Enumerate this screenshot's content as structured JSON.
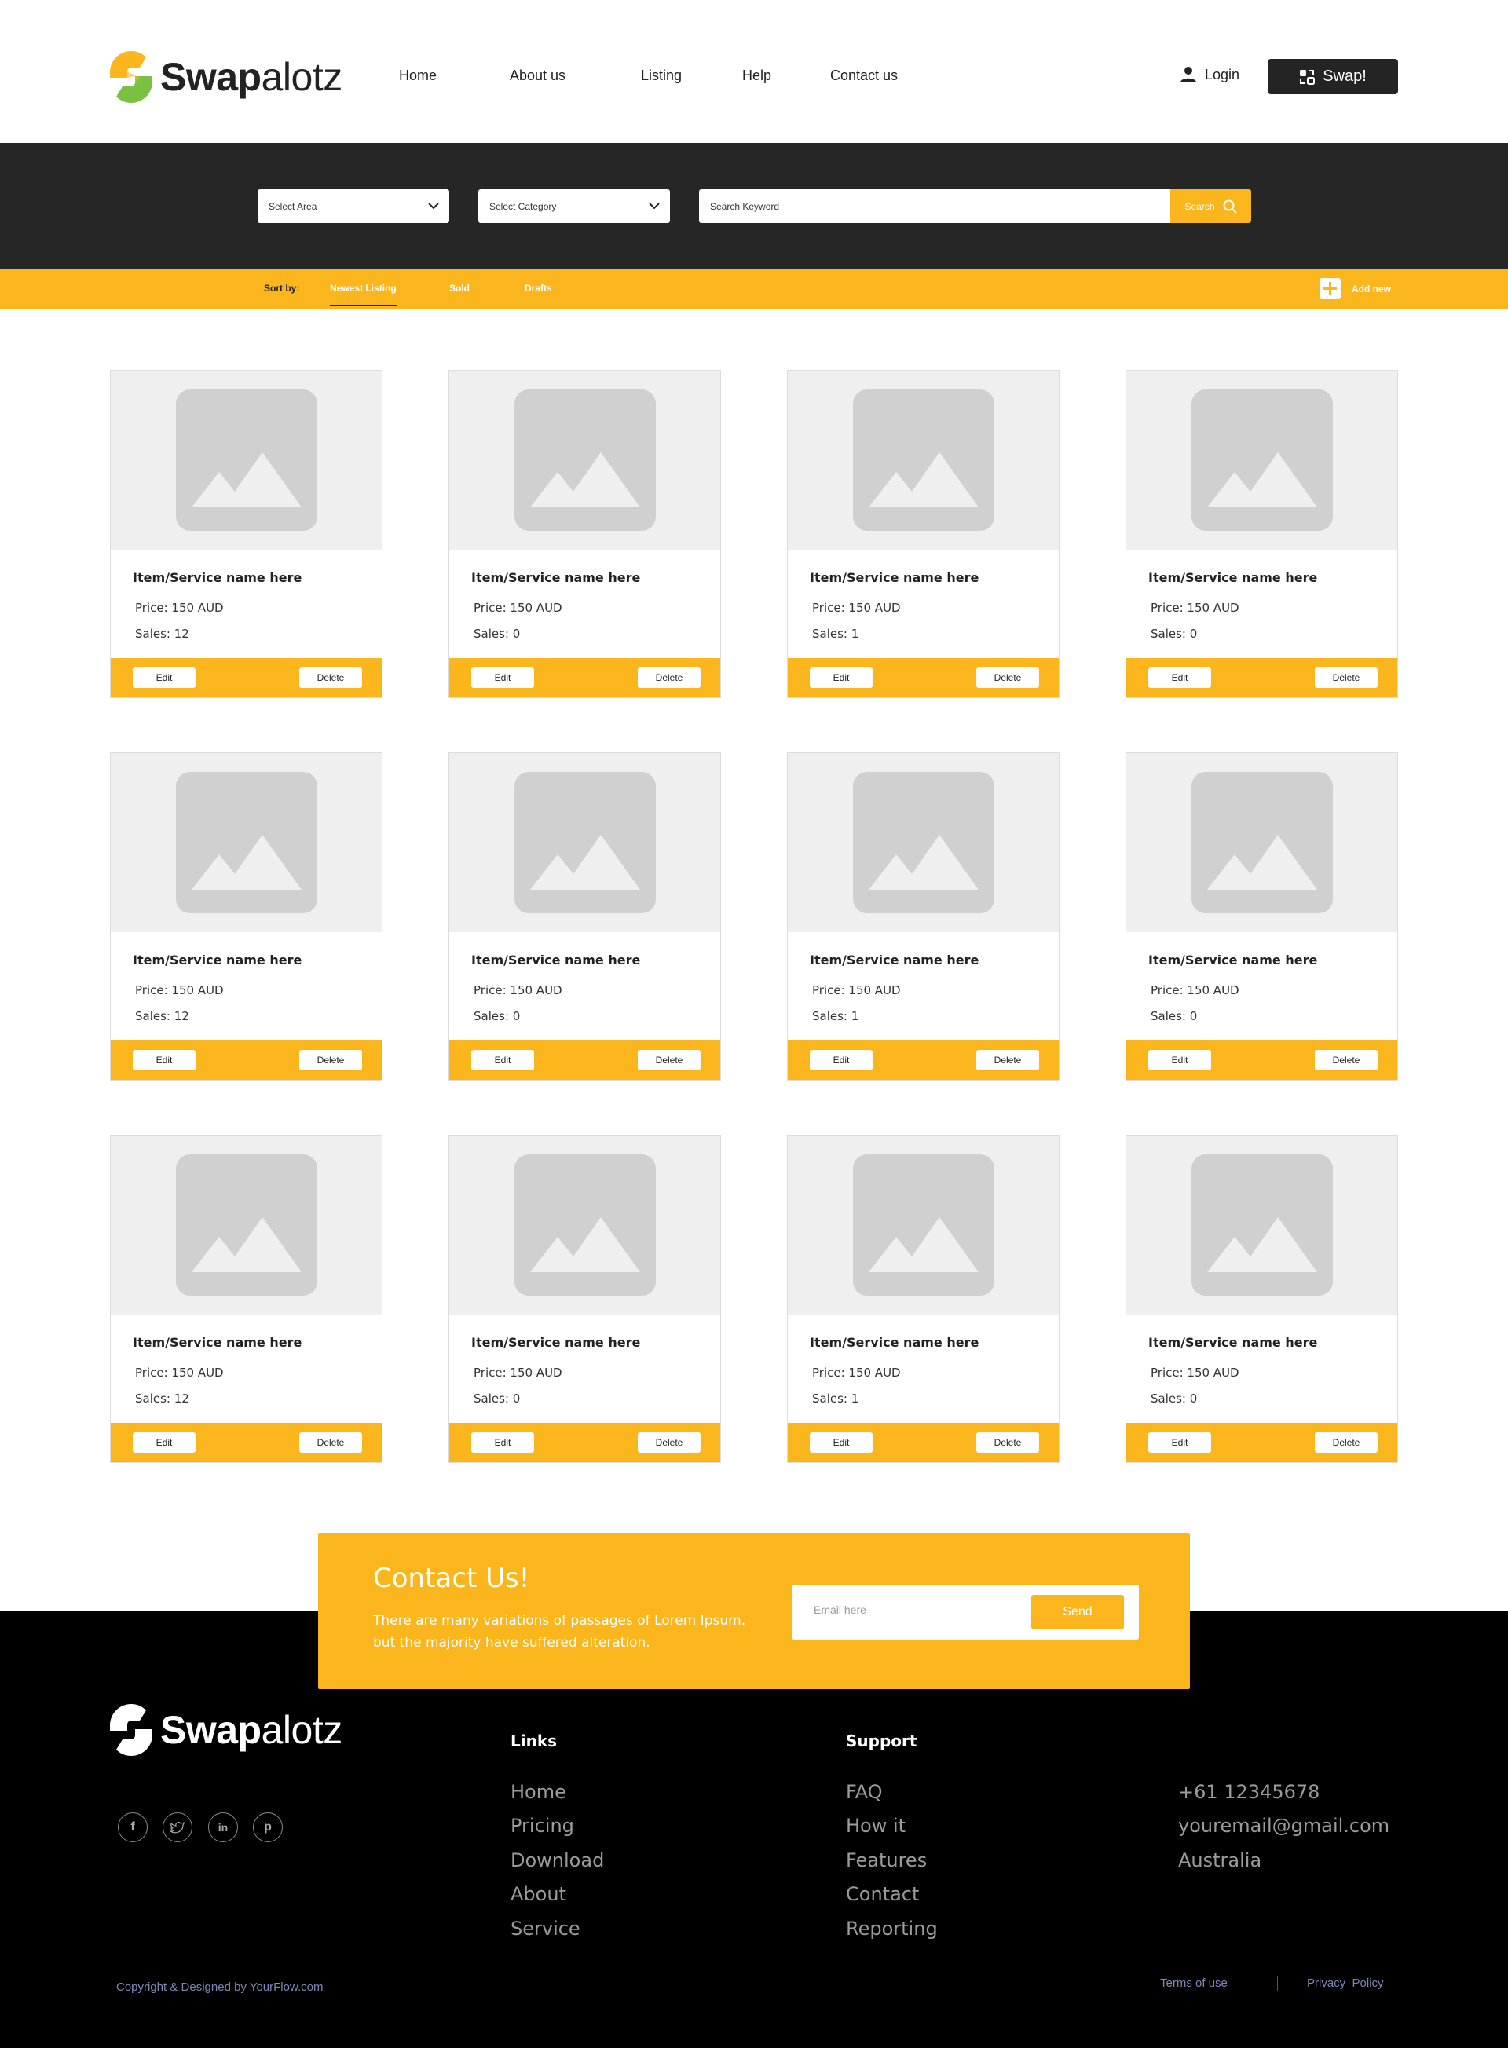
{
  "brand": {
    "name_bold": "Swap",
    "name_light": "alotz",
    "colors": {
      "accent": "#fbb61d",
      "dark": "#262626",
      "green": "#7ac143",
      "footer": "#000000"
    }
  },
  "nav": {
    "items": [
      "Home",
      "About us",
      "Listing",
      "Help",
      "Contact us"
    ],
    "login_label": "Login",
    "swap_label": "Swap!"
  },
  "search": {
    "area_label": "Select Area",
    "category_label": "Select Category",
    "keyword_placeholder": "Search Keyword",
    "button_label": "Search"
  },
  "sort": {
    "label": "Sort by:",
    "tabs": [
      "Newest Listing",
      "Sold",
      "Drafts"
    ],
    "active_tab": "Newest Listing",
    "add_new_label": "Add new"
  },
  "listings": [
    {
      "name": "Item/Service name here",
      "price": "Price: 150 AUD",
      "sales": "Sales: 12",
      "edit": "Edit",
      "delete": "Delete"
    },
    {
      "name": "Item/Service name here",
      "price": "Price: 150 AUD",
      "sales": "Sales: 0",
      "edit": "Edit",
      "delete": "Delete"
    },
    {
      "name": "Item/Service name here",
      "price": "Price: 150 AUD",
      "sales": "Sales: 1",
      "edit": "Edit",
      "delete": "Delete"
    },
    {
      "name": "Item/Service name here",
      "price": "Price: 150 AUD",
      "sales": "Sales: 0",
      "edit": "Edit",
      "delete": "Delete"
    },
    {
      "name": "Item/Service name here",
      "price": "Price: 150 AUD",
      "sales": "Sales: 12",
      "edit": "Edit",
      "delete": "Delete"
    },
    {
      "name": "Item/Service name here",
      "price": "Price: 150 AUD",
      "sales": "Sales: 0",
      "edit": "Edit",
      "delete": "Delete"
    },
    {
      "name": "Item/Service name here",
      "price": "Price: 150 AUD",
      "sales": "Sales: 1",
      "edit": "Edit",
      "delete": "Delete"
    },
    {
      "name": "Item/Service name here",
      "price": "Price: 150 AUD",
      "sales": "Sales: 0",
      "edit": "Edit",
      "delete": "Delete"
    },
    {
      "name": "Item/Service name here",
      "price": "Price: 150 AUD",
      "sales": "Sales: 12",
      "edit": "Edit",
      "delete": "Delete"
    },
    {
      "name": "Item/Service name here",
      "price": "Price: 150 AUD",
      "sales": "Sales: 0",
      "edit": "Edit",
      "delete": "Delete"
    },
    {
      "name": "Item/Service name here",
      "price": "Price: 150 AUD",
      "sales": "Sales: 1",
      "edit": "Edit",
      "delete": "Delete"
    },
    {
      "name": "Item/Service name here",
      "price": "Price: 150 AUD",
      "sales": "Sales: 0",
      "edit": "Edit",
      "delete": "Delete"
    }
  ],
  "contact": {
    "title": "Contact Us!",
    "description": "There are many variations of passages of Lorem Ipsum. but the majority have suffered alteration.",
    "email_placeholder": "Email here",
    "send_label": "Send"
  },
  "footer": {
    "social_icons": [
      "facebook-icon",
      "twitter-icon",
      "linkedin-icon",
      "pinterest-icon"
    ],
    "links_title": "Links",
    "links": [
      "Home",
      "Pricing",
      "Download",
      "About",
      "Service"
    ],
    "support_title": "Support",
    "support": [
      "FAQ",
      "How it",
      "Features",
      "Contact",
      "Reporting"
    ],
    "contact_info": [
      "+61 12345678",
      "youremail@gmail.com",
      "Australia"
    ],
    "copyright": "Copyright & Designed by YourFlow.com",
    "terms": "Terms of use",
    "privacy": "Privacy  Policy"
  }
}
